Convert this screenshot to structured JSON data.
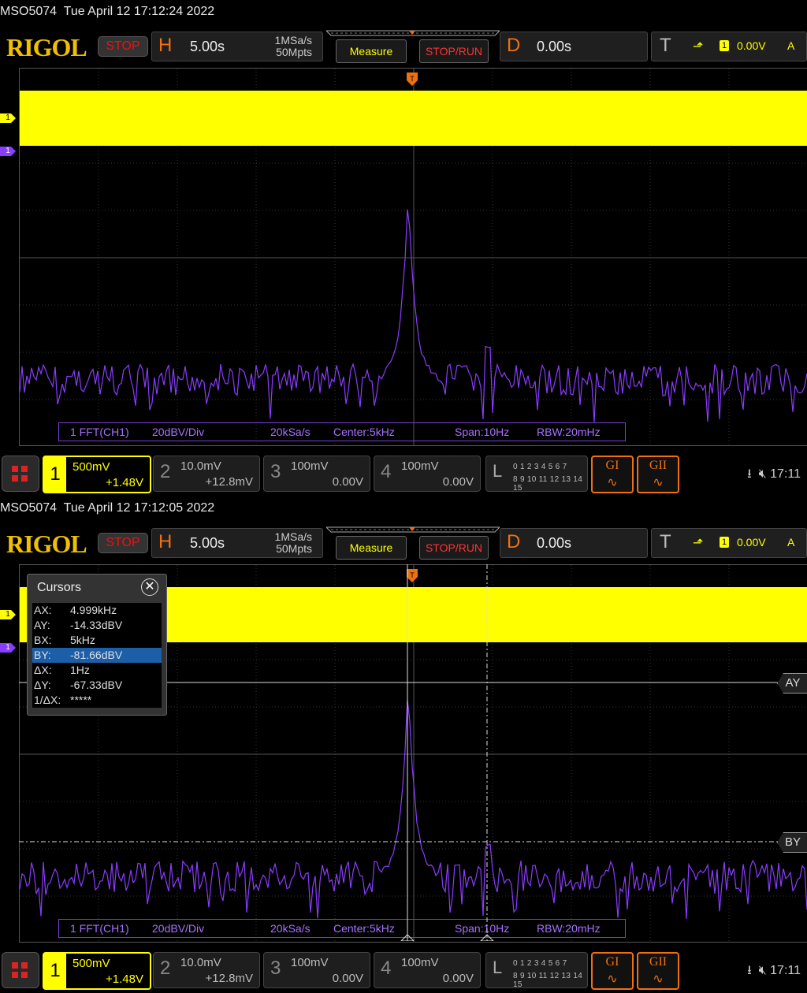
{
  "screens": [
    {
      "title": "MSO5074  Tue April 12 17:12:24 2022",
      "has_cursors": false
    },
    {
      "title": "MSO5074  Tue April 12 17:12:05 2022",
      "has_cursors": true
    }
  ],
  "header": {
    "logo": "RIGOL",
    "run_state": "STOP",
    "h_letter": "H",
    "h_timebase": "5.00s",
    "sample_rate": "1MSa/s",
    "memory_depth": "50Mpts",
    "measure_label": "Measure",
    "stoprun_label": "STOP/RUN",
    "d_letter": "D",
    "delay": "0.00s",
    "t_letter": "T",
    "trigger_channel": "1",
    "trigger_level": "0.00V",
    "trigger_mode": "A"
  },
  "fft_info": {
    "label": "1 FFT(CH1)",
    "scale": "20dBV/Div",
    "rate": "20kSa/s",
    "center": "Center:5kHz",
    "span": "Span:10Hz",
    "rbw": "RBW:20mHz"
  },
  "channels": [
    {
      "num": "1",
      "scale": "500mV",
      "offset": "+1.48V"
    },
    {
      "num": "2",
      "scale": "10.0mV",
      "offset": "+12.8mV"
    },
    {
      "num": "3",
      "scale": "100mV",
      "offset": "0.00V"
    },
    {
      "num": "4",
      "scale": "100mV",
      "offset": "0.00V"
    }
  ],
  "logic": {
    "letter": "L",
    "row1": "0 1 2 3  4 5 6 7",
    "row2": "8 9 10 11 12 13 14 15"
  },
  "generators": [
    "GI",
    "GII"
  ],
  "status_time": "17:11",
  "channel_marker": "1",
  "cursors": {
    "title": "Cursors",
    "rows": [
      {
        "k": "AX:",
        "v": "4.999kHz"
      },
      {
        "k": "AY:",
        "v": "-14.33dBV"
      },
      {
        "k": "BX:",
        "v": "5kHz"
      },
      {
        "k": "BY:",
        "v": "-81.66dBV"
      },
      {
        "k": "ΔX:",
        "v": "1Hz"
      },
      {
        "k": "ΔY:",
        "v": "-67.33dBV"
      },
      {
        "k": "1/ΔX:",
        "v": "*****"
      }
    ],
    "selected_row": 3,
    "ay_tag": "AY",
    "by_tag": "BY"
  },
  "colors": {
    "ch1": "#ffff00",
    "fft": "#8a3cff",
    "accent": "#f07010"
  },
  "icons": [
    "menu-icon",
    "usb-icon",
    "speaker-mute-icon",
    "close-icon",
    "trigger-edge-icon",
    "trigger-position-icon"
  ]
}
